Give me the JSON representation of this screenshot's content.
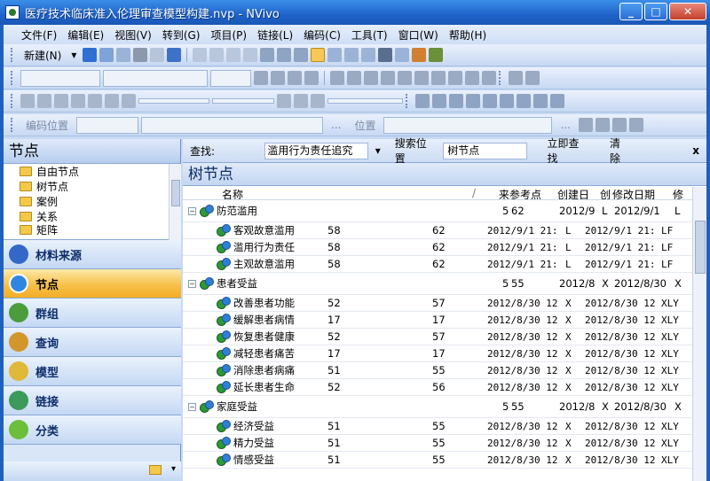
{
  "window": {
    "title": "医疗技术临床准入伦理审查模型构建.nvp - NVivo",
    "minimize": "_",
    "maximize": "□",
    "close": "✕"
  },
  "menu": [
    "文件(F)",
    "编辑(E)",
    "视图(V)",
    "转到(G)",
    "项目(P)",
    "链接(L)",
    "编码(C)",
    "工具(T)",
    "窗口(W)",
    "帮助(H)"
  ],
  "toolbar": {
    "new_label": "新建(N)",
    "coding_position": "编码位置",
    "position": "位置",
    "ellipsis": "..."
  },
  "left": {
    "header": "节点",
    "tree": [
      "自由节点",
      "树节点",
      "案例",
      "关系",
      "矩阵"
    ],
    "nav": [
      "材料来源",
      "节点",
      "群组",
      "查询",
      "模型",
      "链接",
      "分类"
    ],
    "active_nav": "节点"
  },
  "find": {
    "label": "查找:",
    "combo_value": "滥用行为责任追究",
    "search_in": "搜索位置",
    "search_value": "树节点",
    "find_now": "立即查找",
    "clear": "清除",
    "close": "x"
  },
  "right_title": "树节点",
  "columns": [
    "名称",
    "/",
    "来",
    "参考点",
    "创建日",
    "创",
    "修改日期",
    "修"
  ],
  "rows": [
    {
      "type": "parent",
      "name": "防范滥用",
      "sources": "5",
      "refs": "62",
      "created": "2012/9",
      "cby": "L",
      "modified": "2012/9/1",
      "mby": "L"
    },
    {
      "type": "child",
      "name": "客观故意滥用",
      "sources": "58",
      "refs": "62",
      "created": "2012/9/1 21:",
      "cby": "L",
      "modified": "2012/9/1 21:",
      "mby": "LF"
    },
    {
      "type": "child",
      "name": "滥用行为责任",
      "sources": "58",
      "refs": "62",
      "created": "2012/9/1 21:",
      "cby": "L",
      "modified": "2012/9/1 21:",
      "mby": "LF"
    },
    {
      "type": "child",
      "name": "主观故意滥用",
      "sources": "58",
      "refs": "62",
      "created": "2012/9/1 21:",
      "cby": "L",
      "modified": "2012/9/1 21:",
      "mby": "LF"
    },
    {
      "type": "parent",
      "name": "患者受益",
      "sources": "5",
      "refs": "55",
      "created": "2012/8",
      "cby": "X",
      "modified": "2012/8/30",
      "mby": "X"
    },
    {
      "type": "child",
      "name": "改善患者功能",
      "sources": "52",
      "refs": "57",
      "created": "2012/8/30 12",
      "cby": "X",
      "modified": "2012/8/30 12",
      "mby": "XLY"
    },
    {
      "type": "child",
      "name": "缓解患者病情",
      "sources": "17",
      "refs": "17",
      "created": "2012/8/30 12",
      "cby": "X",
      "modified": "2012/8/30 12",
      "mby": "XLY"
    },
    {
      "type": "child",
      "name": "恢复患者健康",
      "sources": "52",
      "refs": "57",
      "created": "2012/8/30 12",
      "cby": "X",
      "modified": "2012/8/30 12",
      "mby": "XLY"
    },
    {
      "type": "child",
      "name": "减轻患者痛苦",
      "sources": "17",
      "refs": "17",
      "created": "2012/8/30 12",
      "cby": "X",
      "modified": "2012/8/30 12",
      "mby": "XLY"
    },
    {
      "type": "child",
      "name": "消除患者病痛",
      "sources": "51",
      "refs": "55",
      "created": "2012/8/30 12",
      "cby": "X",
      "modified": "2012/8/30 12",
      "mby": "XLY"
    },
    {
      "type": "child",
      "name": "延长患者生命",
      "sources": "52",
      "refs": "56",
      "created": "2012/8/30 12",
      "cby": "X",
      "modified": "2012/8/30 12",
      "mby": "XLY"
    },
    {
      "type": "parent",
      "name": "家庭受益",
      "sources": "5",
      "refs": "55",
      "created": "2012/8",
      "cby": "X",
      "modified": "2012/8/30",
      "mby": "X"
    },
    {
      "type": "child",
      "name": "经济受益",
      "sources": "51",
      "refs": "55",
      "created": "2012/8/30 12",
      "cby": "X",
      "modified": "2012/8/30 12",
      "mby": "XLY"
    },
    {
      "type": "child",
      "name": "精力受益",
      "sources": "51",
      "refs": "55",
      "created": "2012/8/30 12",
      "cby": "X",
      "modified": "2012/8/30 12",
      "mby": "XLY"
    },
    {
      "type": "child",
      "name": "情感受益",
      "sources": "51",
      "refs": "55",
      "created": "2012/8/30 12",
      "cby": "X",
      "modified": "2012/8/30 12",
      "mby": "XLY"
    }
  ],
  "colors": {
    "titlebar": "#1f63c9",
    "active_nav": "#f7c04a",
    "frame": "#c7daf2"
  }
}
